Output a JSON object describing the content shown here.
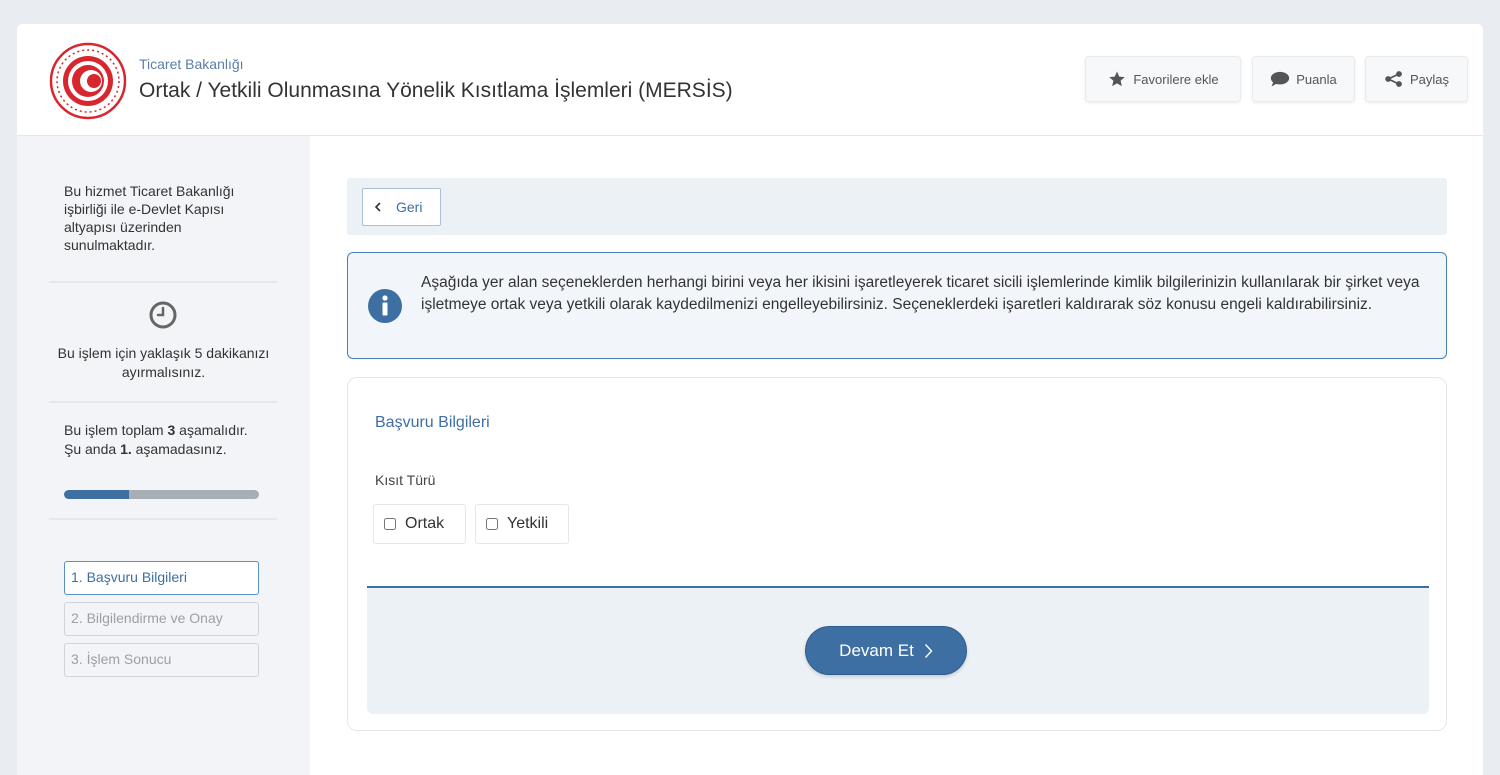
{
  "header": {
    "org_name": "Ticaret Bakanlığı",
    "service_title": "Ortak / Yetkili Olunmasına Yönelik Kısıtlama İşlemleri (MERSİS)",
    "buttons": {
      "favorite": "Favorilere ekle",
      "rate": "Puanla",
      "share": "Paylaş"
    }
  },
  "sidebar": {
    "provider_text": "Bu hizmet Ticaret Bakanlığı işbirliği ile e-Devlet Kapısı altyapısı üzerinden sunulmaktadır.",
    "duration_text": "Bu işlem için yaklaşık 5 dakikanızı ayırmalısınız.",
    "steps_text": {
      "prefix": "Bu işlem toplam ",
      "total": "3",
      "middle": " aşamalıdır. Şu anda ",
      "current": "1.",
      "suffix": " aşamadasınız."
    },
    "progress_fraction": 0.333,
    "steps": [
      {
        "label": "1. Başvuru Bilgileri",
        "active": true
      },
      {
        "label": "2. Bilgilendirme ve Onay",
        "active": false
      },
      {
        "label": "3. İşlem Sonucu",
        "active": false
      }
    ]
  },
  "main": {
    "back_label": "Geri",
    "info_text": "Aşağıda yer alan seçeneklerden herhangi birini veya her ikisini işaretleyerek ticaret sicili işlemlerinde kimlik bilgilerinizin kullanılarak bir şirket veya işletmeye ortak veya yetkili olarak kaydedilmenizi engelleyebilirsiniz. Seçeneklerdeki işaretleri kaldırarak söz konusu engeli kaldırabilirsiniz.",
    "form": {
      "section_title": "Başvuru Bilgileri",
      "field_label": "Kısıt Türü",
      "options": [
        {
          "label": "Ortak",
          "checked": false
        },
        {
          "label": "Yetkili",
          "checked": false
        }
      ],
      "submit_label": "Devam Et"
    }
  },
  "colors": {
    "primary": "#3e6fa3",
    "emblem_red": "#d7262e",
    "sidebar_bg": "#f2f4f7"
  }
}
